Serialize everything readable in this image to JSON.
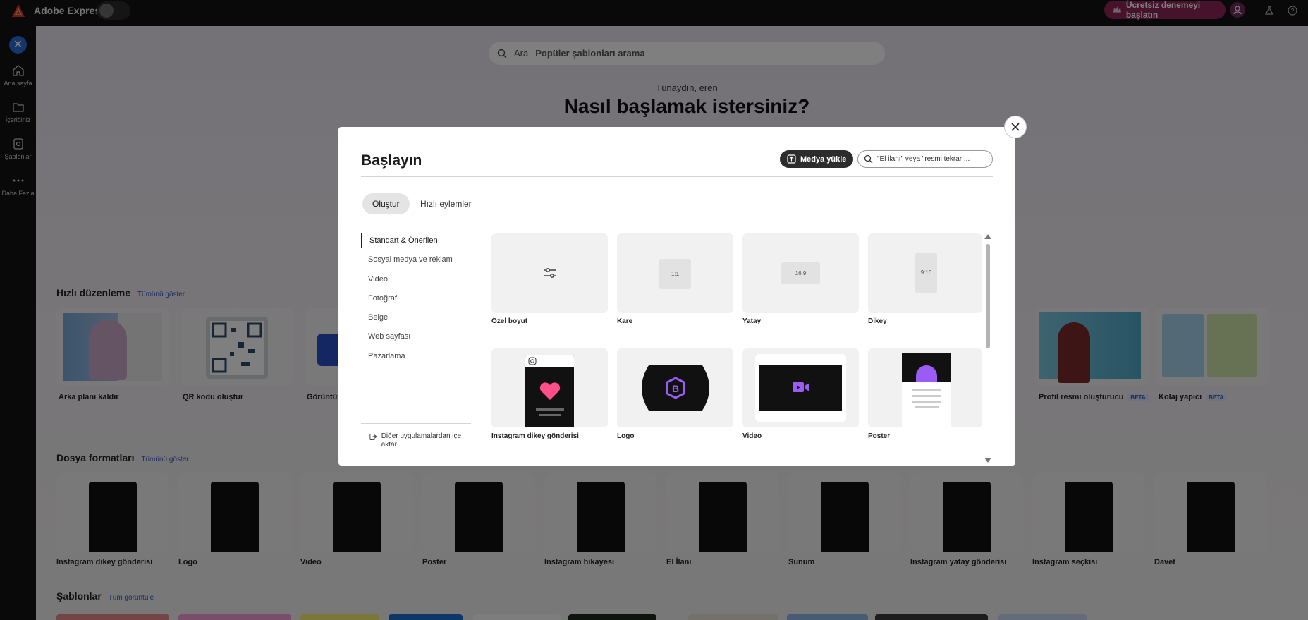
{
  "topbar": {
    "app_title": "Adobe Express",
    "trial_label": "Ücretsiz denemeyi başlatın",
    "colors": {
      "trial_bg": "#8f2457",
      "bar_bg": "#121212"
    }
  },
  "rail": {
    "items": [
      {
        "label": "Ana sayfa",
        "icon": "home-icon"
      },
      {
        "label": "İçeriğiniz",
        "icon": "folder-icon"
      },
      {
        "label": "Şablonlar",
        "icon": "templates-icon"
      },
      {
        "label": "Daha Fazla",
        "icon": "more-icon"
      }
    ]
  },
  "main": {
    "search": {
      "prefix": "Ara",
      "placeholder": "Popüler şablonları arama"
    },
    "greeting": "Tünaydın, eren",
    "headline": "Nasıl başlamak istersiniz?",
    "quick_edit": {
      "title": "Hızlı düzenleme",
      "link": "Tümünü göster",
      "cards": [
        {
          "label": "Arka planı kaldır"
        },
        {
          "label": "QR kodu oluştur"
        },
        {
          "label": "Görüntüyü"
        },
        {
          "label": "Profil resmi oluşturucu",
          "badge": "BETA"
        },
        {
          "label": "Kolaj yapıcı",
          "badge": "BETA"
        }
      ]
    },
    "file_formats": {
      "title": "Dosya formatları",
      "link": "Tümünü göster",
      "cards": [
        {
          "label": "Instagram dikey gönderisi"
        },
        {
          "label": "Logo"
        },
        {
          "label": "Video"
        },
        {
          "label": "Poster"
        },
        {
          "label": "Instagram hikayesi"
        },
        {
          "label": "El İlanı"
        },
        {
          "label": "Sunum"
        },
        {
          "label": "Instagram yatay gönderisi"
        },
        {
          "label": "Instagram seçkisi"
        },
        {
          "label": "Davet"
        }
      ]
    },
    "templates": {
      "title": "Şablonlar",
      "link": "Tüm görüntüle"
    }
  },
  "modal": {
    "title": "Başlayın",
    "upload_label": "Medya yükle",
    "search_placeholder": "\"El ilanı\" veya \"resmi tekrar ...",
    "tabs": [
      "Oluştur",
      "Hızlı eylemler"
    ],
    "categories": [
      "Standart & Önerilen",
      "Sosyal medya ve reklam",
      "Video",
      "Fotoğraf",
      "Belge",
      "Web sayfası",
      "Pazarlama"
    ],
    "import_label": "Diğer uygulamalardan içe aktar",
    "tiles": [
      {
        "label": "Özel boyut",
        "ratio": ""
      },
      {
        "label": "Kare",
        "ratio": "1:1"
      },
      {
        "label": "Yatay",
        "ratio": "16:9"
      },
      {
        "label": "Dikey",
        "ratio": "9:16"
      },
      {
        "label": "Instagram dikey gönderisi"
      },
      {
        "label": "Logo"
      },
      {
        "label": "Video"
      },
      {
        "label": "Poster"
      }
    ],
    "colors": {
      "accent_purple": "#9b5cf6",
      "heart_pink": "#ff4f8b"
    }
  }
}
